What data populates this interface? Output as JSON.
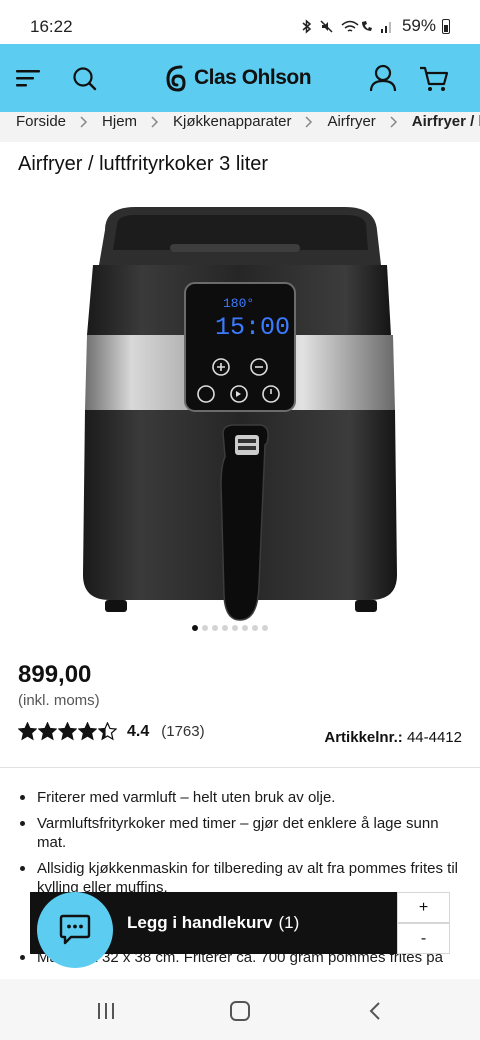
{
  "status_bar": {
    "time": "16:22",
    "battery": "59%",
    "icons": [
      "bluetooth-icon",
      "mute-icon",
      "wifi-call-icon",
      "signal-icon",
      "battery-icon"
    ]
  },
  "header": {
    "brand": "Clas Ohlson",
    "background_color": "#5ccdf0",
    "icons": [
      "menu-icon",
      "search-icon",
      "user-icon",
      "cart-icon"
    ]
  },
  "breadcrumb": [
    "Forside",
    "Hjem",
    "Kjøkkenapparater",
    "Airfryer",
    "Airfryer / l"
  ],
  "product": {
    "title": "Airfryer / luftfrityrkoker 3 liter",
    "display_temp": "180°",
    "display_time": "15:00",
    "price": "899,00",
    "price_note": "(inkl. moms)",
    "rating": 4.4,
    "rating_label": "4.4",
    "rating_count": "(1763)",
    "article_label": "Artikkelnr.:",
    "article_number": "44-4412",
    "image_count": 8,
    "active_image": 0
  },
  "features": [
    "Friterer med varmluft – helt uten bruk av olje.",
    "Varmluftsfrityrkoker med timer – gjør det enklere å lage sunn mat.",
    "Allsidig kjøkkenmaskin for tilbereding av alt fra pommes frites til kylling eller muffins.",
    "Mål: 28 x 32 x 38 cm. Friterer ca. 700 gram pommes frites på"
  ],
  "cart_bar": {
    "label": "Legg i handlekurv",
    "count": "(1)",
    "plus": "+",
    "minus": "-"
  }
}
